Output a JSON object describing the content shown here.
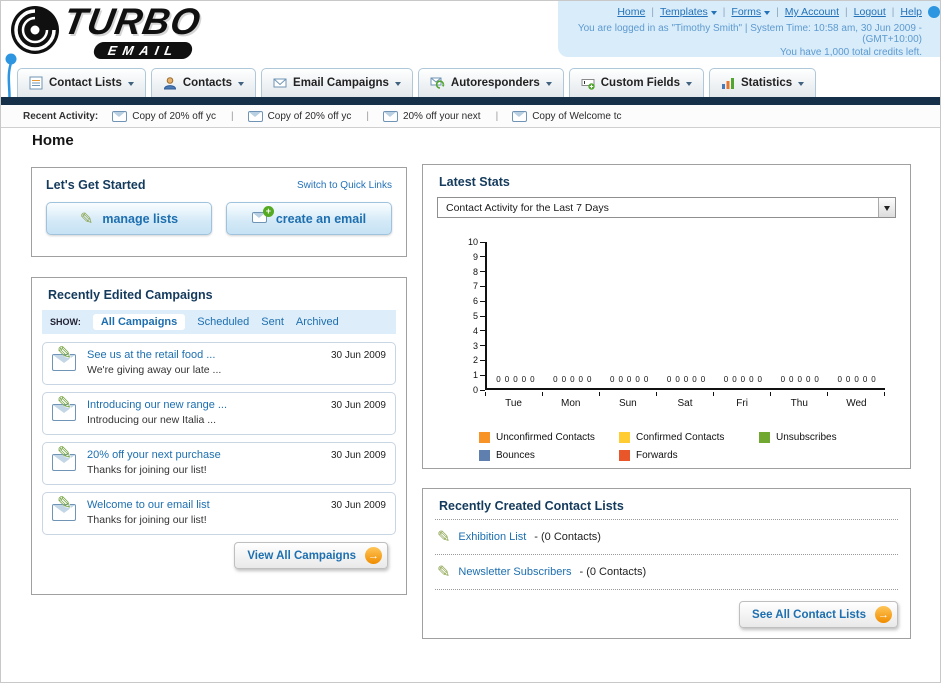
{
  "header": {
    "logo_text": "TURBO",
    "logo_sub": "EMAIL",
    "links": [
      {
        "label": "Home",
        "dropdown": false
      },
      {
        "label": "Templates",
        "dropdown": true
      },
      {
        "label": "Forms",
        "dropdown": true
      },
      {
        "label": "My Account",
        "dropdown": false
      },
      {
        "label": "Logout",
        "dropdown": false
      },
      {
        "label": "Help",
        "dropdown": false
      }
    ],
    "login_info": "You are logged in as \"Timothy Smith\" | System Time: 10:58 am, 30 Jun 2009 - (GMT+10:00)",
    "credits_info": "You have 1,000 total credits left."
  },
  "nav": {
    "tabs": [
      {
        "label": "Contact Lists",
        "icon": "contact-lists-icon"
      },
      {
        "label": "Contacts",
        "icon": "contacts-icon"
      },
      {
        "label": "Email Campaigns",
        "icon": "email-campaigns-icon"
      },
      {
        "label": "Autoresponders",
        "icon": "autoresponders-icon"
      },
      {
        "label": "Custom Fields",
        "icon": "custom-fields-icon"
      },
      {
        "label": "Statistics",
        "icon": "statistics-icon"
      }
    ]
  },
  "recent_activity": {
    "label": "Recent Activity:",
    "items": [
      "Copy of 20% off yc",
      "Copy of 20% off yc",
      "20% off your next",
      "Copy of Welcome tc"
    ]
  },
  "page": {
    "title": "Home"
  },
  "get_started": {
    "title": "Let's Get Started",
    "switch_link": "Switch to Quick Links",
    "manage_lists_label": "manage lists",
    "create_email_label": "create an email"
  },
  "campaigns": {
    "title": "Recently Edited Campaigns",
    "show_label": "SHOW:",
    "filters": [
      "All Campaigns",
      "Scheduled",
      "Sent",
      "Archived"
    ],
    "items": [
      {
        "title": "See us at the retail food ...",
        "subtitle": "We're giving away our late ...",
        "date": "30 Jun 2009"
      },
      {
        "title": "Introducing our new range ...",
        "subtitle": "Introducing our new Italia ...",
        "date": "30 Jun 2009"
      },
      {
        "title": "20% off your next purchase",
        "subtitle": "Thanks for joining our list!",
        "date": "30 Jun 2009"
      },
      {
        "title": "Welcome to our email list",
        "subtitle": "Thanks for joining our list!",
        "date": "30 Jun 2009"
      }
    ],
    "view_all_label": "View All Campaigns"
  },
  "stats": {
    "title": "Latest Stats",
    "selected_option": "Contact Activity for the Last 7 Days"
  },
  "chart_data": {
    "type": "bar",
    "title": "Contact Activity for the Last 7 Days",
    "categories": [
      "Tue",
      "Mon",
      "Sun",
      "Sat",
      "Fri",
      "Thu",
      "Wed"
    ],
    "series": [
      {
        "name": "Unconfirmed Contacts",
        "color": "#f79327",
        "values": [
          0,
          0,
          0,
          0,
          0,
          0,
          0
        ]
      },
      {
        "name": "Confirmed Contacts",
        "color": "#ffcc33",
        "values": [
          0,
          0,
          0,
          0,
          0,
          0,
          0
        ]
      },
      {
        "name": "Unsubscribes",
        "color": "#71a832",
        "values": [
          0,
          0,
          0,
          0,
          0,
          0,
          0
        ]
      },
      {
        "name": "Bounces",
        "color": "#5f7fae",
        "values": [
          0,
          0,
          0,
          0,
          0,
          0,
          0
        ]
      },
      {
        "name": "Forwards",
        "color": "#e8562a",
        "values": [
          0,
          0,
          0,
          0,
          0,
          0,
          0
        ]
      }
    ],
    "ylim": [
      0,
      10
    ],
    "ystep": 1,
    "grid": false,
    "legend_position": "bottom",
    "show_value_labels": true
  },
  "contact_lists": {
    "title": "Recently Created Contact Lists",
    "items": [
      {
        "name": "Exhibition List",
        "count": "- (0 Contacts)"
      },
      {
        "name": "Newsletter Subscribers",
        "count": "- (0 Contacts)"
      }
    ],
    "see_all_label": "See All Contact Lists"
  },
  "colors": {
    "accent_orange": "#f08c00",
    "link_blue": "#1d6fb0",
    "nav_bar_dark": "#16304a",
    "header_info_bg": "#d9ecfa"
  }
}
